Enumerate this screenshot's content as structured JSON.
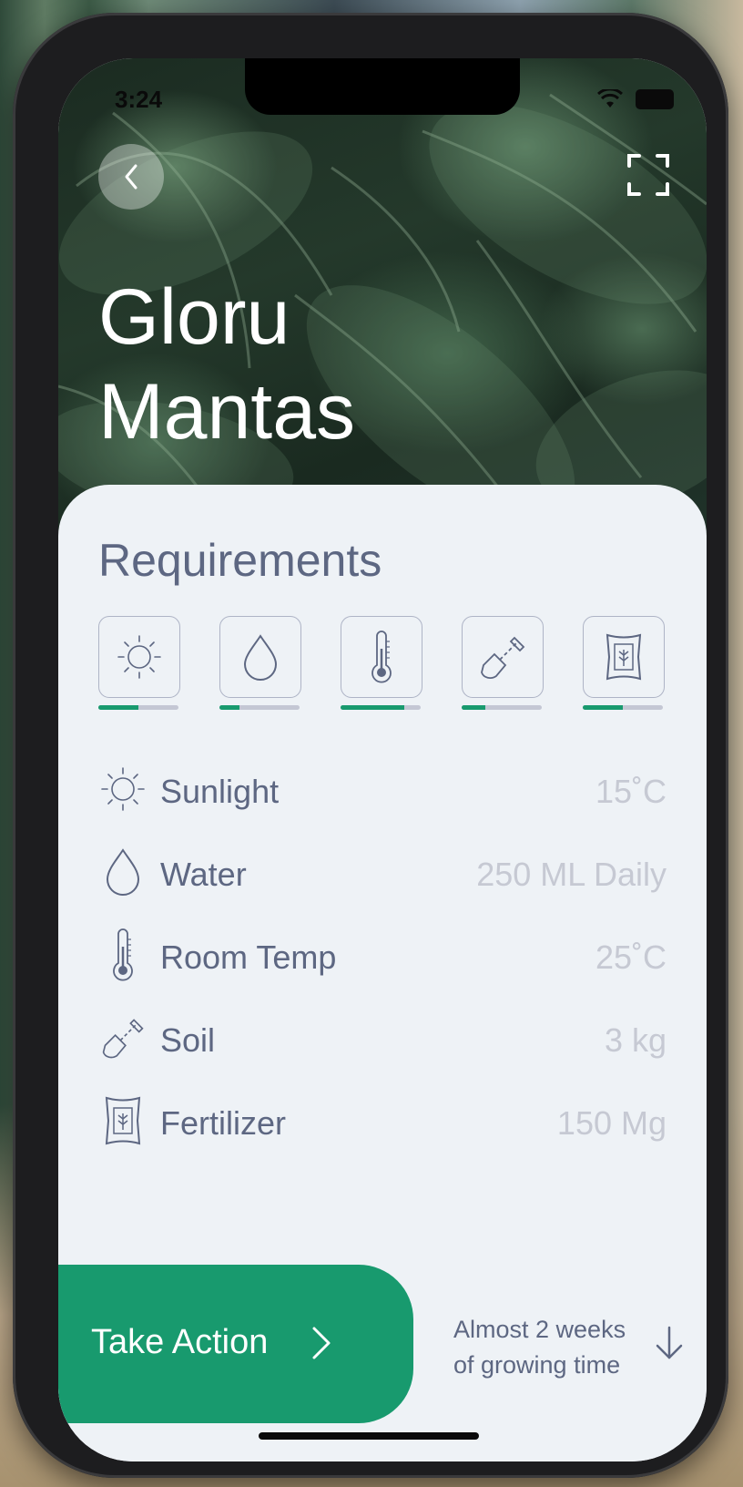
{
  "status_bar": {
    "time": "3:24"
  },
  "header": {
    "title_line1": "Gloru",
    "title_line2": "Mantas"
  },
  "icons": {
    "back": "chevron-left-icon",
    "expand": "expand-icon",
    "sunlight": "sun-icon",
    "water": "water-drop-icon",
    "temp": "thermometer-icon",
    "soil": "shovel-icon",
    "fertilizer": "fertilizer-bag-icon"
  },
  "requirements": {
    "title": "Requirements",
    "levels": [
      {
        "name": "sunlight",
        "level": 0.5
      },
      {
        "name": "water",
        "level": 0.25
      },
      {
        "name": "temp",
        "level": 0.8
      },
      {
        "name": "soil",
        "level": 0.3
      },
      {
        "name": "fertilizer",
        "level": 0.5
      }
    ],
    "items": [
      {
        "label": "Sunlight",
        "value": "15˚C"
      },
      {
        "label": "Water",
        "value": "250 ML Daily"
      },
      {
        "label": "Room Temp",
        "value": "25˚C"
      },
      {
        "label": "Soil",
        "value": "3 kg"
      },
      {
        "label": "Fertilizer",
        "value": "150 Mg"
      }
    ]
  },
  "footer": {
    "action_label": "Take Action",
    "growing_line1": "Almost 2 weeks",
    "growing_line2": "of growing time"
  },
  "colors": {
    "accent": "#189a6e",
    "text": "#5d6782",
    "muted": "#c6c9d3",
    "sheet": "#eef2f6"
  }
}
